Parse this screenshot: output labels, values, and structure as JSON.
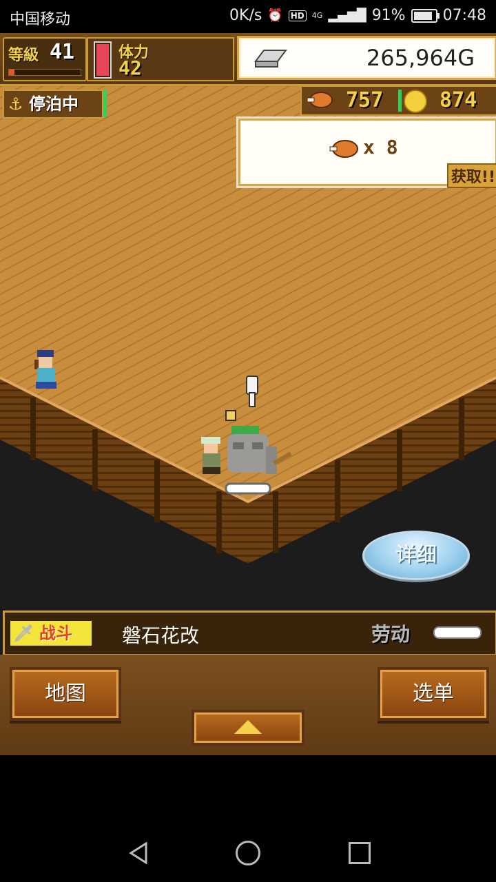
{
  "status_bar": {
    "carrier": "中国移动",
    "net_speed": "0K/s",
    "hd": "HD",
    "network": "4G",
    "battery": "91%",
    "time": "07:48"
  },
  "hud": {
    "level_label": "等級",
    "level": "41",
    "stamina_label": "体力",
    "stamina": "42",
    "gold": "265,964G",
    "anchor_status": "停泊中",
    "meat_count": "757",
    "coin_count": "874"
  },
  "reward": {
    "quantity": "x 8",
    "get_label": "获取!!"
  },
  "detail_button": "详细",
  "info_bar": {
    "battle_label": "战斗",
    "monster_name": "磐石花改",
    "labor_label": "劳动"
  },
  "panel": {
    "map_button": "地图",
    "menu_button": "选单"
  },
  "colors": {
    "deck": "#c98d3e",
    "gold_text": "#f4d14a",
    "ui_wood": "#6b4315"
  }
}
